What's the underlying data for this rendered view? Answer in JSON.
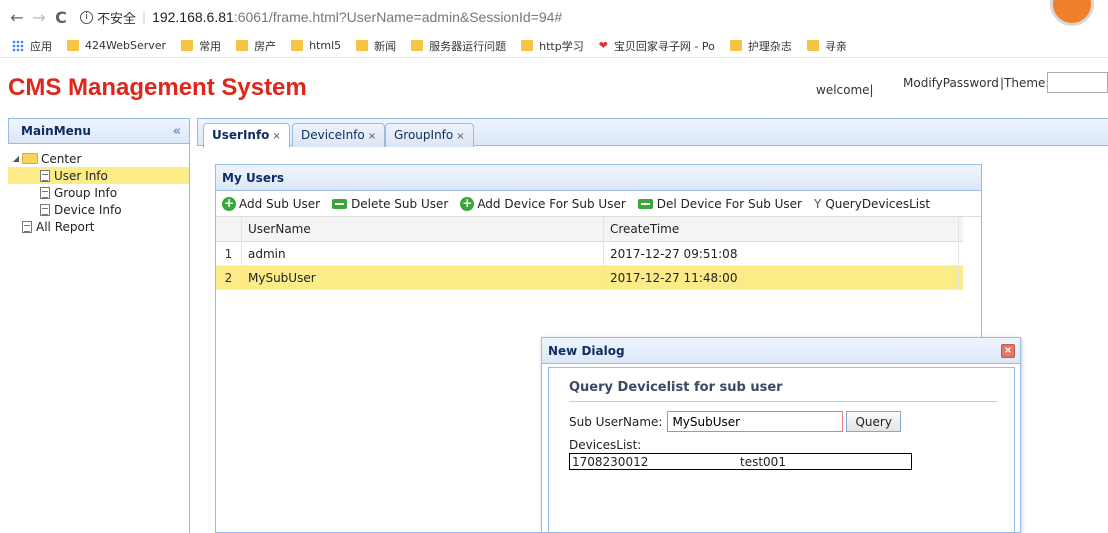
{
  "browser": {
    "back_glyph": "←",
    "forward_glyph": "→",
    "reload_glyph": "C",
    "info_glyph": "i",
    "security_label": "不安全",
    "url_host": "192.168.6.81",
    "url_rest": ":6061/frame.html?UserName=admin&SessionId=94#",
    "bookmarks": [
      "应用",
      "424WebServer",
      "常用",
      "房产",
      "html5",
      "新闻",
      "服务器运行问题",
      "http学习",
      "宝贝回家寻子网 - Po",
      "护理杂志",
      "寻亲"
    ]
  },
  "header": {
    "title": "CMS Management System",
    "welcome": "welcome|",
    "modify_password": "ModifyPassword",
    "theme_label": "|Theme:",
    "theme_value": ""
  },
  "sidebar": {
    "title": "MainMenu",
    "collapse_glyph": "«",
    "root": "Center",
    "items": [
      "User Info",
      "Group Info",
      "Device Info"
    ],
    "other": "All Report"
  },
  "tabs": [
    {
      "label": "UserInfo",
      "close": "×"
    },
    {
      "label": "DeviceInfo",
      "close": "×"
    },
    {
      "label": "GroupInfo",
      "close": "×"
    }
  ],
  "panel": {
    "title": "My Users",
    "toolbar": {
      "add_sub_user": "Add Sub User",
      "delete_sub_user": "Delete Sub User",
      "add_device": "Add Device For Sub User",
      "del_device": "Del Device For Sub User",
      "query_devices": "QueryDevicesList"
    },
    "columns": [
      "UserName",
      "CreateTime"
    ],
    "rows": [
      {
        "num": "1",
        "name": "admin",
        "time": "2017-12-27 09:51:08"
      },
      {
        "num": "2",
        "name": "MySubUser",
        "time": "2017-12-27 11:48:00"
      }
    ]
  },
  "dialog": {
    "title": "New Dialog",
    "close_glyph": "×",
    "heading": "Query Devicelist for sub user",
    "sub_username_label": "Sub UserName:",
    "sub_username_value": "MySubUser",
    "query_button": "Query",
    "devices_label": "DevicesList:",
    "device_id": "1708230012",
    "device_name": "test001"
  }
}
